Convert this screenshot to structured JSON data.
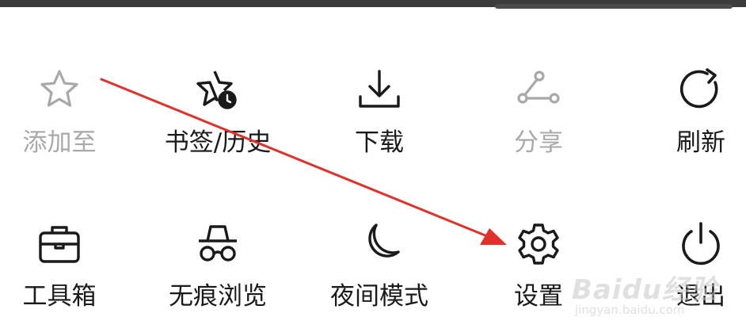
{
  "menu": {
    "row1": [
      {
        "label": "添加至",
        "icon": "star-outline-icon",
        "disabled": true
      },
      {
        "label": "书签/历史",
        "icon": "star-clock-icon",
        "disabled": false
      },
      {
        "label": "下载",
        "icon": "download-icon",
        "disabled": false
      },
      {
        "label": "分享",
        "icon": "share-icon",
        "disabled": true
      },
      {
        "label": "刷新",
        "icon": "refresh-icon",
        "disabled": false
      }
    ],
    "row2": [
      {
        "label": "工具箱",
        "icon": "toolbox-icon",
        "disabled": false
      },
      {
        "label": "无痕浏览",
        "icon": "incognito-icon",
        "disabled": false
      },
      {
        "label": "夜间模式",
        "icon": "moon-icon",
        "disabled": false
      },
      {
        "label": "设置",
        "icon": "gear-icon",
        "disabled": false
      },
      {
        "label": "退出",
        "icon": "power-icon",
        "disabled": false
      }
    ]
  },
  "watermark": {
    "logo": "Baidu经验",
    "url": "jingyan.baidu.com"
  },
  "colors": {
    "text": "#1a1a1a",
    "disabled_text": "#a9a9a9",
    "icon": "#1a1a1a",
    "disabled_icon": "#a9a9a9",
    "annotation_arrow": "#e0322a"
  }
}
